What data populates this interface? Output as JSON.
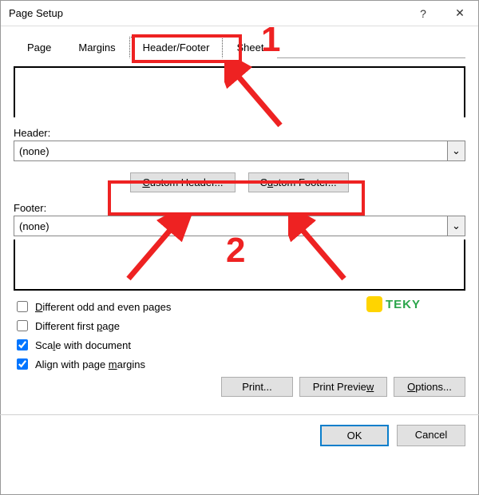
{
  "window": {
    "title": "Page Setup",
    "help_label": "?",
    "close_label": "✕"
  },
  "tabs": {
    "page": "Page",
    "margins": "Margins",
    "header_footer": "Header/Footer",
    "sheet": "Sheet"
  },
  "labels": {
    "header": "Header:",
    "footer": "Footer:"
  },
  "combos": {
    "header_value": "(none)",
    "footer_value": "(none)",
    "chevron": "⌄"
  },
  "buttons": {
    "custom_header": "Custom Header...",
    "custom_footer": "Custom Footer...",
    "print": "Print...",
    "print_preview": "Print Preview",
    "options": "Options...",
    "ok": "OK",
    "cancel": "Cancel"
  },
  "checks": {
    "diff_odd_even": "Different odd and even pages",
    "diff_first": "Different first page",
    "scale_doc": "Scale with document",
    "align_margins": "Align with page margins"
  },
  "annotations": {
    "num1": "1",
    "num2": "2"
  },
  "logo": {
    "text": "TEKY"
  }
}
